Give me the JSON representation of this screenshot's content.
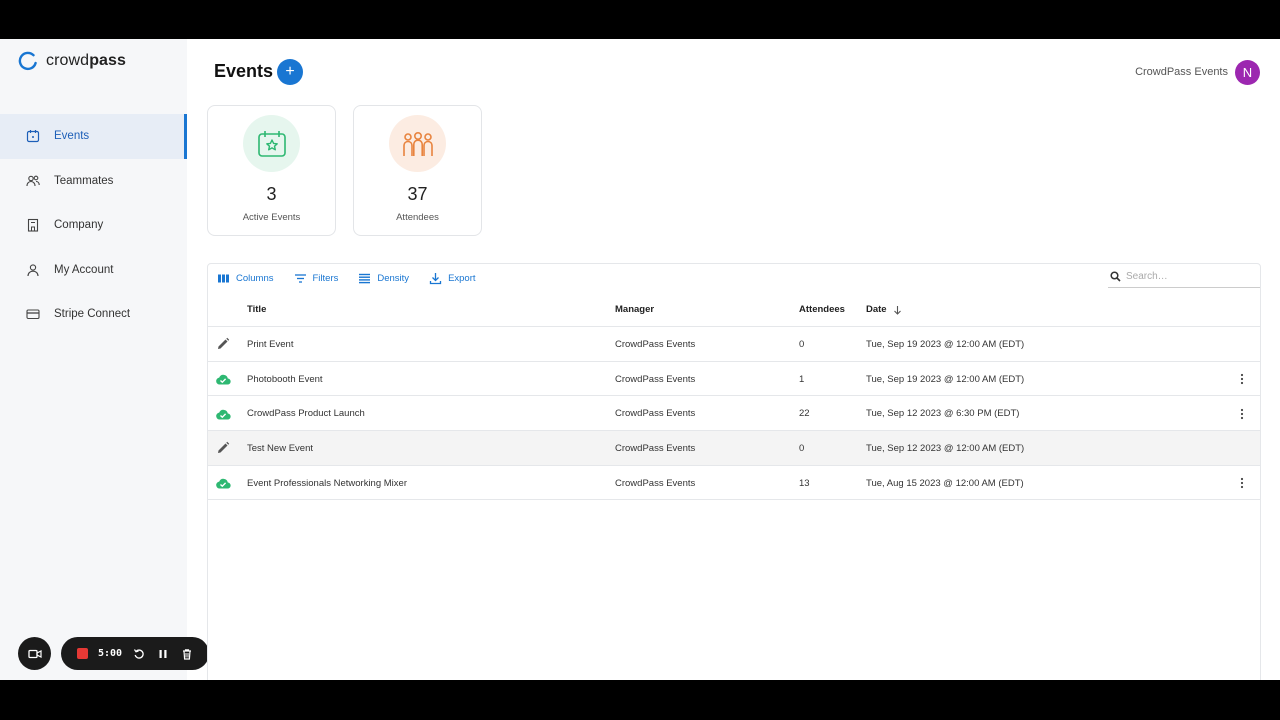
{
  "app": {
    "brand_prefix": "crowd",
    "brand_suffix": "pass",
    "accent": "#1976d2"
  },
  "sidebar": {
    "items": [
      {
        "label": "Events",
        "icon": "calendar-icon",
        "active": true
      },
      {
        "label": "Teammates",
        "icon": "people-icon",
        "active": false
      },
      {
        "label": "Company",
        "icon": "building-icon",
        "active": false
      },
      {
        "label": "My Account",
        "icon": "person-icon",
        "active": false
      },
      {
        "label": "Stripe Connect",
        "icon": "credit-card-icon",
        "active": false
      }
    ]
  },
  "header": {
    "title": "Events",
    "add_label": "+",
    "org_name": "CrowdPass Events",
    "avatar_letter": "N"
  },
  "stats": [
    {
      "value": "3",
      "label": "Active Events",
      "icon": "calendar-star-icon",
      "color": "#2eb872"
    },
    {
      "value": "37",
      "label": "Attendees",
      "icon": "group-icon",
      "color": "#e8843f"
    }
  ],
  "toolbar": {
    "columns": "Columns",
    "filters": "Filters",
    "density": "Density",
    "export": "Export",
    "search_placeholder": "Search…"
  },
  "table": {
    "headers": {
      "title": "Title",
      "manager": "Manager",
      "attendees": "Attendees",
      "date": "Date"
    },
    "rows": [
      {
        "status": "draft",
        "title": "Print Event",
        "manager": "CrowdPass Events",
        "attendees": "0",
        "date": "Tue, Sep 19 2023 @ 12:00 AM (EDT)",
        "menu": false
      },
      {
        "status": "published",
        "title": "Photobooth Event",
        "manager": "CrowdPass Events",
        "attendees": "1",
        "date": "Tue, Sep 19 2023 @ 12:00 AM (EDT)",
        "menu": true
      },
      {
        "status": "published",
        "title": "CrowdPass Product Launch",
        "manager": "CrowdPass Events",
        "attendees": "22",
        "date": "Tue, Sep 12 2023 @ 6:30 PM (EDT)",
        "menu": true
      },
      {
        "status": "draft",
        "title": "Test New Event",
        "manager": "CrowdPass Events",
        "attendees": "0",
        "date": "Tue, Sep 12 2023 @ 12:00 AM (EDT)",
        "menu": false
      },
      {
        "status": "published",
        "title": "Event Professionals Networking Mixer",
        "manager": "CrowdPass Events",
        "attendees": "13",
        "date": "Tue, Aug 15 2023 @ 12:00 AM (EDT)",
        "menu": true
      }
    ]
  },
  "recorder": {
    "time": "5:00"
  }
}
